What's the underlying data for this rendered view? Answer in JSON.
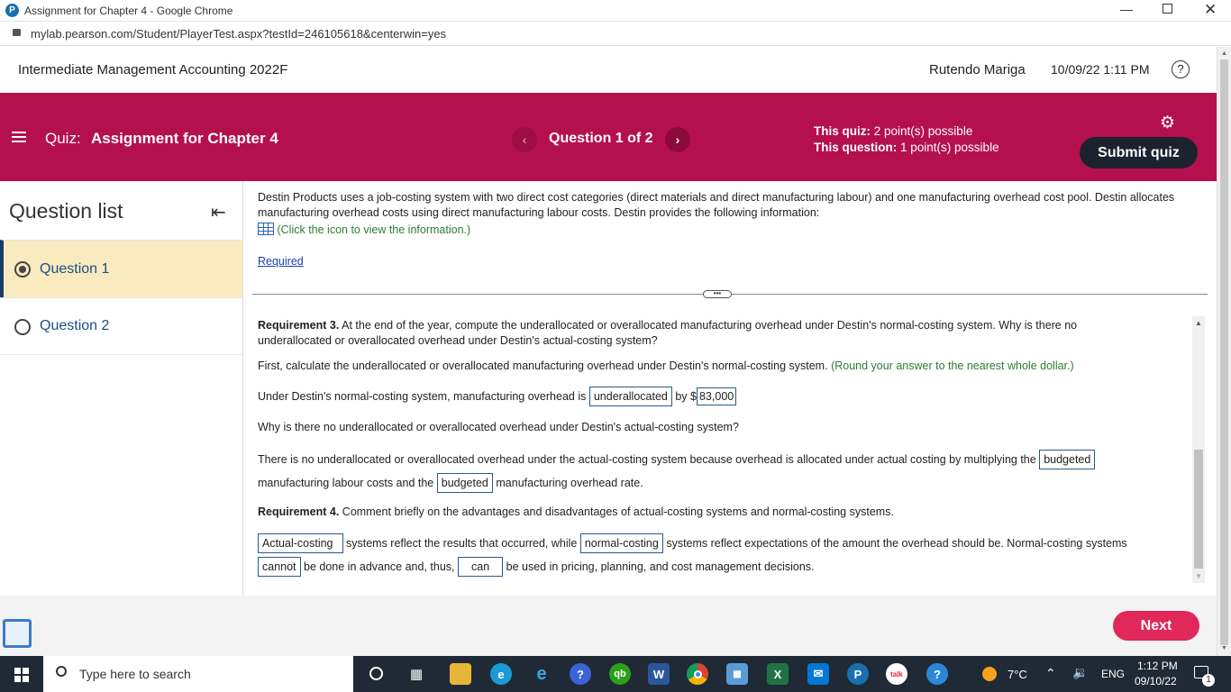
{
  "browser": {
    "tab_title": "Assignment for Chapter 4 - Google Chrome",
    "url": "mylab.pearson.com/Student/PlayerTest.aspx?testId=246105618&centerwin=yes"
  },
  "header": {
    "course_title": "Intermediate Management Accounting 2022F",
    "user_name": "Rutendo Mariga",
    "datetime": "10/09/22 1:11 PM"
  },
  "quizbar": {
    "quiz_prefix": "Quiz:",
    "quiz_name": "Assignment for Chapter 4",
    "question_nav": "Question 1 of 2",
    "this_quiz_label": "This quiz:",
    "this_quiz_value": "2 point(s) possible",
    "this_question_label": "This question:",
    "this_question_value": "1 point(s) possible",
    "submit_label": "Submit quiz"
  },
  "sidebar": {
    "title": "Question list",
    "items": [
      {
        "label": "Question 1"
      },
      {
        "label": "Question 2"
      }
    ]
  },
  "content": {
    "intro": "Destin Products uses a job-costing system with two direct cost categories (direct materials and direct manufacturing labour) and one manufacturing overhead cost pool. Destin allocates manufacturing overhead costs using direct manufacturing labour costs. Destin provides the following information:",
    "info_link": "(Click the icon to view the information.)",
    "required_link": "Required",
    "req3_bold": "Requirement 3.",
    "req3_text": "At the end of the year, compute the underallocated or overallocated manufacturing overhead under Destin's normal-costing system. Why is there no underallocated or overallocated overhead under Destin's actual-costing system?",
    "first_calc": "First, calculate the underallocated or overallocated manufacturing overhead under Destin's normal-costing system.",
    "round_hint": "(Round your answer to the nearest whole dollar.)",
    "under_pre": "Under Destin's normal-costing system, manufacturing overhead is",
    "ans_alloc": "underallocated",
    "under_by": "by $",
    "ans_amount": "83,000",
    "why_q": "Why is there no underallocated or overallocated overhead under Destin's actual-costing system?",
    "no_under_pre": "There is no underallocated or overallocated overhead under the actual-costing system because overhead is allocated under actual costing by multiplying the",
    "ans_budgeted1": "budgeted",
    "mfg_labour": "manufacturing labour costs and the",
    "ans_budgeted2": "budgeted",
    "mfg_rate": "manufacturing overhead rate.",
    "req4_bold": "Requirement 4.",
    "req4_text": "Comment briefly on the advantages and disadvantages of actual-costing systems and normal-costing systems.",
    "ans_actual": "Actual-costing",
    "sys_reflect": "systems reflect the results that occurred, while",
    "ans_normal": "normal-costing",
    "sys_expect": "systems reflect expectations of the amount the overhead should be. Normal-costing systems",
    "ans_cannot": "cannot",
    "be_done": "be done in advance and, thus,",
    "ans_can": "can",
    "be_used": "be used in pricing, planning, and cost management decisions."
  },
  "footer": {
    "next_label": "Next"
  },
  "taskbar": {
    "search_placeholder": "Type here to search",
    "weather": "7°C",
    "lang": "ENG",
    "time": "1:12 PM",
    "date": "09/10/22",
    "notif_count": "1"
  },
  "colors": {
    "brand": "#b5104e",
    "selected_item_bg": "#f9ebbf",
    "next_button": "#e0285a",
    "submit_button": "#1c2230"
  }
}
